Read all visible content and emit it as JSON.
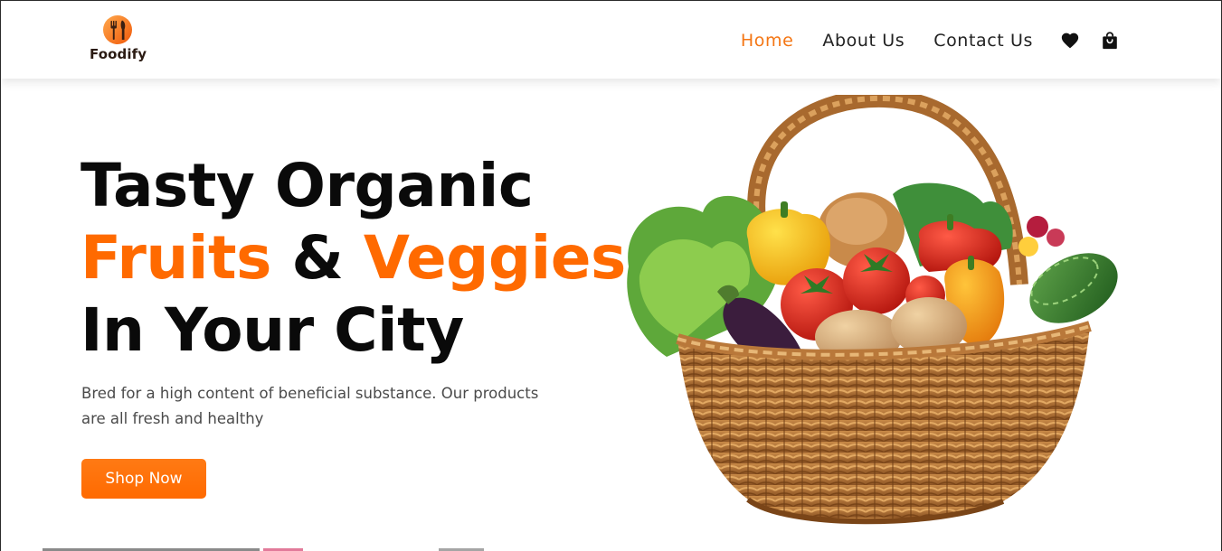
{
  "header": {
    "brand": "Foodify",
    "nav": [
      {
        "label": "Home",
        "active": true
      },
      {
        "label": "About Us",
        "active": false
      },
      {
        "label": "Contact Us",
        "active": false
      }
    ],
    "icons": [
      "heart-icon",
      "shopping-bag-icon"
    ]
  },
  "hero": {
    "title_line1": "Tasty Organic",
    "title_line2_a": "Fruits",
    "title_line2_b": " & ",
    "title_line2_c": "Veggies",
    "title_line3": "In Your City",
    "description": "Bred for a high content of beneficial substance. Our products are all fresh and healthy",
    "cta_label": "Shop Now"
  },
  "colors": {
    "accent": "#ff6a00",
    "nav_active": "#f47614",
    "text_dark": "#0a0a0a",
    "text_muted": "#4a4a4a"
  }
}
